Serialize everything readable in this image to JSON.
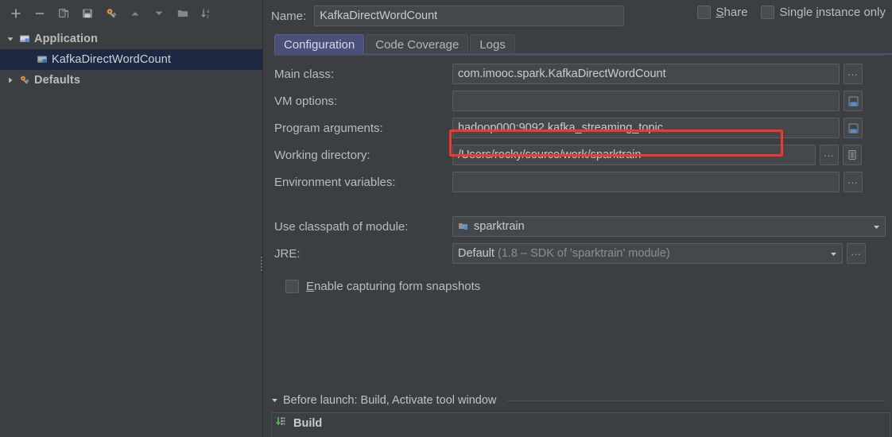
{
  "sidebar": {
    "toolbar": [
      {
        "name": "add-button",
        "icon": "plus-icon",
        "label": "+"
      },
      {
        "name": "remove-button",
        "icon": "minus-icon",
        "label": "−"
      },
      {
        "name": "copy-button",
        "icon": "copy-icon",
        "label": "Copy Configuration"
      },
      {
        "name": "save-button",
        "icon": "save-icon",
        "label": "Save Configuration"
      },
      {
        "name": "edit-defaults-button",
        "icon": "wrench-icon",
        "label": "Edit defaults"
      },
      {
        "name": "move-up-button",
        "icon": "arrow-up-icon",
        "label": "Move Up"
      },
      {
        "name": "move-down-button",
        "icon": "arrow-down-icon",
        "label": "Move Down"
      },
      {
        "name": "new-folder-button",
        "icon": "folder-icon",
        "label": "Create New Folder"
      },
      {
        "name": "sort-button",
        "icon": "sort-az-icon",
        "label": "Sort Configurations"
      }
    ],
    "tree": [
      {
        "label": "Application",
        "icon": "application-icon",
        "expanded": true,
        "level": 0,
        "selected": false
      },
      {
        "label": "KafkaDirectWordCount",
        "icon": "application-icon",
        "level": 1,
        "selected": true
      },
      {
        "label": "Defaults",
        "icon": "wrench-icon",
        "expanded": false,
        "level": 0,
        "selected": false
      }
    ]
  },
  "header": {
    "name_label": "Name:",
    "name_value": "KafkaDirectWordCount",
    "share": {
      "label_pre": "",
      "mnemonic": "S",
      "label_post": "hare",
      "checked": false
    },
    "single_instance": {
      "label_pre": "Single ",
      "mnemonic": "i",
      "label_post": "nstance only",
      "checked": false
    }
  },
  "tabs": [
    {
      "label": "Configuration",
      "active": true
    },
    {
      "label": "Code Coverage",
      "active": false
    },
    {
      "label": "Logs",
      "active": false
    }
  ],
  "form": {
    "main_class": {
      "label": "Main class:",
      "value": "com.imooc.spark.KafkaDirectWordCount",
      "button": "...",
      "button_icon": "ellipsis-icon"
    },
    "vm_options": {
      "label": "VM options:",
      "value": "",
      "button_icon": "expand-macro-icon"
    },
    "program_arguments": {
      "label": "Program arguments:",
      "value": "hadoop000:9092 kafka_streaming_topic",
      "button_icon": "expand-macro-icon",
      "highlighted": true
    },
    "working_directory": {
      "label": "Working directory:",
      "value": "/Users/rocky/source/work/sparktrain",
      "button": "...",
      "button_icon": "ellipsis-icon",
      "button2_icon": "macro-list-icon"
    },
    "environment_variables": {
      "label": "Environment variables:",
      "value": "",
      "button": "...",
      "button_icon": "ellipsis-icon"
    },
    "use_classpath": {
      "label": "Use classpath of module:",
      "value": "sparktrain",
      "icon": "module-icon",
      "arrow_icon": "chevron-down-icon"
    },
    "jre": {
      "label": "JRE:",
      "value_strong": "Default",
      "value_grayed": "(1.8 – SDK of 'sparktrain' module)",
      "arrow_icon": "chevron-down-icon",
      "button": "...",
      "button_icon": "ellipsis-icon"
    },
    "enable_snapshots": {
      "mnemonic": "E",
      "label_post": "nable capturing form snapshots",
      "checked": false
    }
  },
  "before_launch": {
    "header": "Before launch: Build, Activate tool window",
    "collapse_icon": "triangle-down-icon",
    "items": [
      {
        "label": "Build",
        "icon": "build-icon"
      }
    ]
  },
  "colors": {
    "background": "#3c3f41",
    "field_background": "#45484a",
    "selection": "#1d2943",
    "tab_active": "#4b507a",
    "highlight_red": "#f5362a",
    "text": "#bbbbbb"
  }
}
